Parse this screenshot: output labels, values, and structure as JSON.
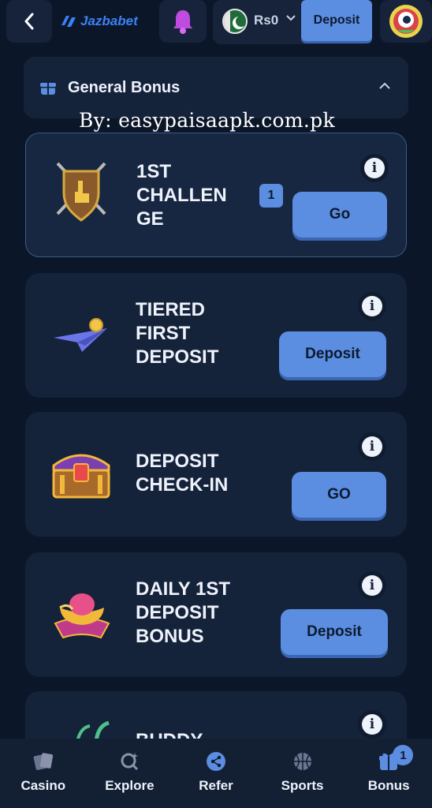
{
  "header": {
    "logo_text": "Jazbabet",
    "balance": "Rs0",
    "deposit_label": "Deposit"
  },
  "section": {
    "title": "General Bonus"
  },
  "watermark": "By: easypaisaapk.com.pk",
  "cards": [
    {
      "title": "1ST CHALLEN GE",
      "badge": "1",
      "button": "Go"
    },
    {
      "title": "TIERED FIRST DEPOSIT",
      "button": "Deposit"
    },
    {
      "title": "DEPOSIT CHECK-IN",
      "button": "GO"
    },
    {
      "title": "DAILY 1ST DEPOSIT BONUS",
      "button": "Deposit"
    },
    {
      "title": "BUDDY"
    }
  ],
  "bottom_nav": {
    "items": [
      {
        "label": "Casino",
        "icon": "cards-icon"
      },
      {
        "label": "Explore",
        "icon": "explore-icon"
      },
      {
        "label": "Refer",
        "icon": "share-icon"
      },
      {
        "label": "Sports",
        "icon": "basketball-icon"
      },
      {
        "label": "Bonus",
        "icon": "gift-icon",
        "badge": "1"
      }
    ]
  },
  "colors": {
    "background": "#0b1628",
    "card": "#14223a",
    "accent": "#5b8de0"
  }
}
